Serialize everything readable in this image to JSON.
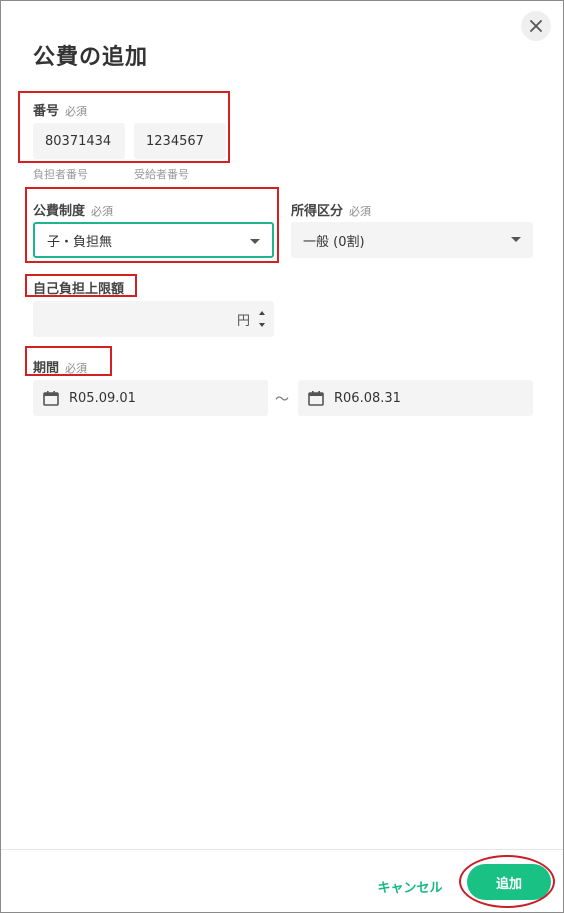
{
  "dialog": {
    "title": "公費の追加"
  },
  "number": {
    "label": "番号",
    "required": "必須",
    "payer_value": "80371434",
    "recipient_value": "1234567",
    "payer_helper": "負担者番号",
    "recipient_helper": "受給者番号"
  },
  "system": {
    "label": "公費制度",
    "required": "必須",
    "value": "子・負担無"
  },
  "income": {
    "label": "所得区分",
    "required": "必須",
    "value": "一般 (0割)"
  },
  "limit": {
    "label": "自己負担上限額",
    "unit": "円"
  },
  "period": {
    "label": "期間",
    "required": "必須",
    "start": "R05.09.01",
    "separator": "～",
    "end": "R06.08.31"
  },
  "footer": {
    "cancel_label": "キャンセル",
    "add_label": "追加"
  },
  "colors": {
    "accent": "#19c185",
    "highlight": "#d42020"
  }
}
